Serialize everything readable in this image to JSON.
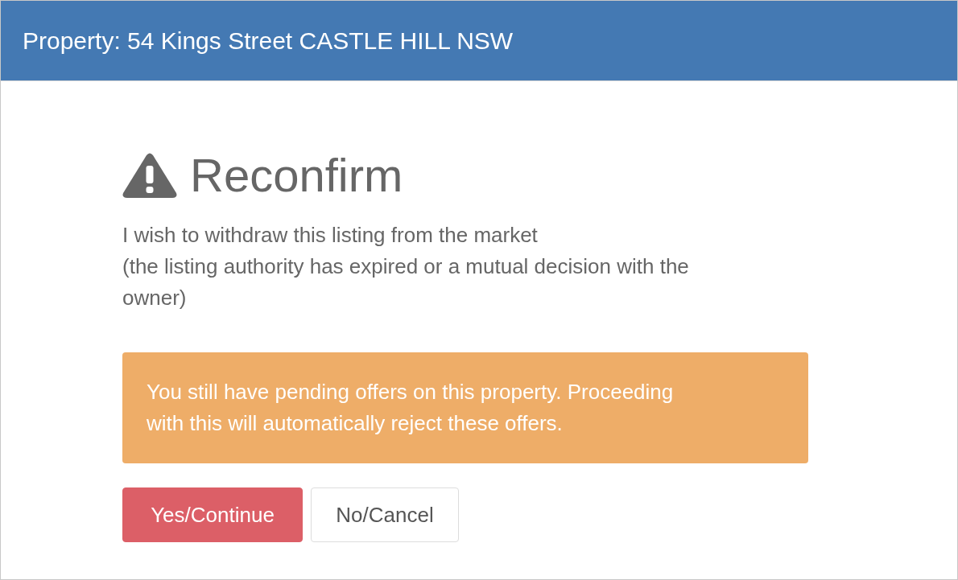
{
  "header": {
    "title": "Property: 54 Kings Street CASTLE HILL NSW"
  },
  "dialog": {
    "heading": "Reconfirm",
    "message_lines": [
      "I wish to withdraw this listing from the market",
      "(the listing authority has expired or a mutual decision with the owner)"
    ],
    "alert": {
      "kind": "warning",
      "text": "You still have pending offers on this property. Proceeding with this will automatically reject these offers."
    },
    "buttons": [
      {
        "label": "Yes/Continue",
        "kind": "danger"
      },
      {
        "label": "No/Cancel",
        "kind": "default"
      }
    ]
  }
}
